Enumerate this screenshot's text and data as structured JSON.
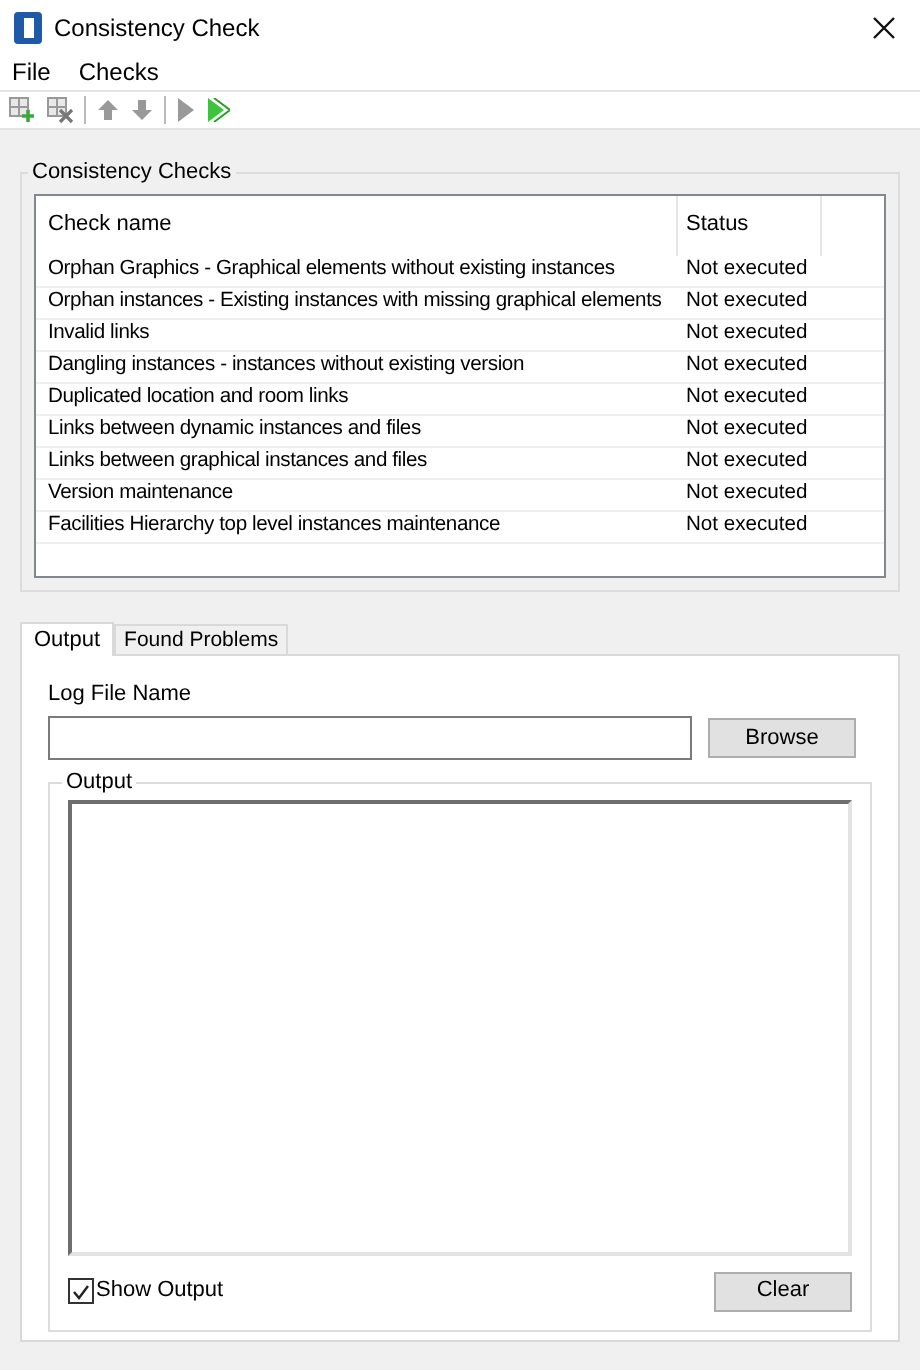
{
  "window": {
    "title": "Consistency Check"
  },
  "menu": [
    "File",
    "Checks"
  ],
  "checks_group": {
    "title": "Consistency Checks",
    "columns": [
      "Check name",
      "Status"
    ],
    "rows": [
      {
        "name": "Orphan Graphics - Graphical elements without existing instances",
        "status": "Not executed"
      },
      {
        "name": "Orphan instances - Existing instances with missing graphical elements",
        "status": "Not executed"
      },
      {
        "name": "Invalid links",
        "status": "Not executed"
      },
      {
        "name": "Dangling instances - instances without existing version",
        "status": "Not executed"
      },
      {
        "name": "Duplicated location and room links",
        "status": "Not executed"
      },
      {
        "name": "Links between dynamic instances and files",
        "status": "Not executed"
      },
      {
        "name": "Links between graphical instances and files",
        "status": "Not executed"
      },
      {
        "name": "Version maintenance",
        "status": "Not executed"
      },
      {
        "name": "Facilities Hierarchy top level instances maintenance",
        "status": "Not executed"
      }
    ]
  },
  "tabs": [
    {
      "label": "Output",
      "selected": true
    },
    {
      "label": "Found Problems",
      "selected": false
    }
  ],
  "output_tab": {
    "log_label": "Log File Name",
    "browse_button": "Browse",
    "output_group": "Output",
    "show_output": {
      "label": "Show Output",
      "checked": true
    },
    "clear_button": "Clear"
  }
}
